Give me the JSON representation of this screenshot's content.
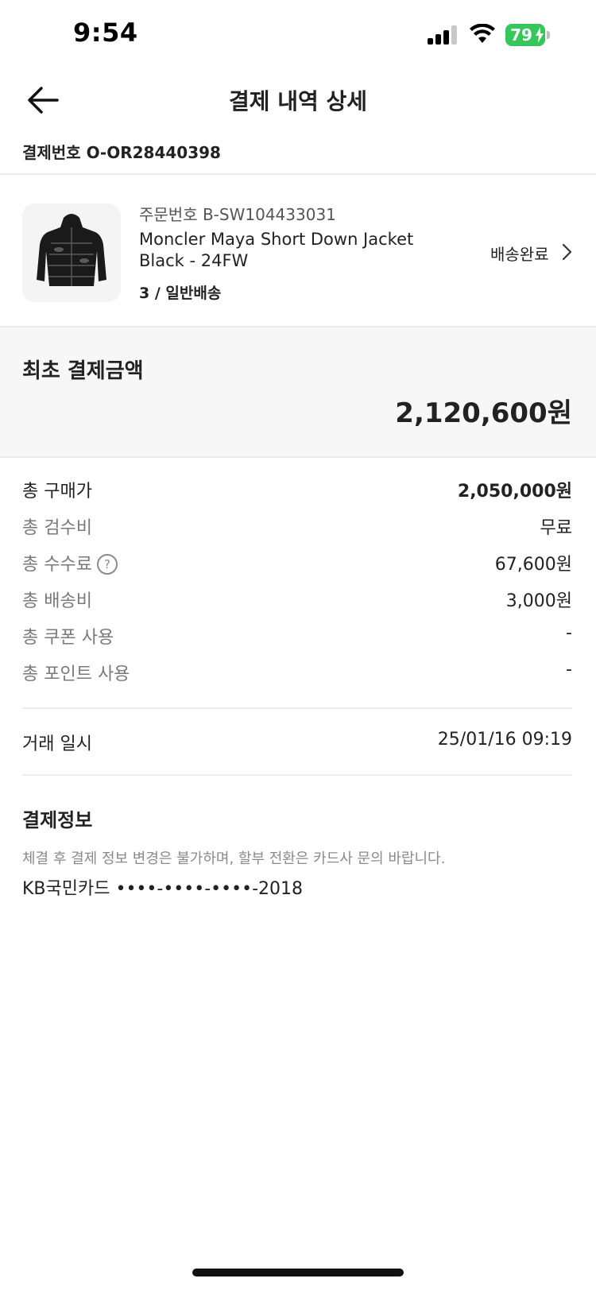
{
  "status_bar": {
    "time": "9:54",
    "battery": "79",
    "icons": [
      "cellular-signal-icon",
      "wifi-icon",
      "battery-charging-icon"
    ]
  },
  "nav": {
    "back_icon": "arrow-left-icon",
    "title": "결제 내역 상세"
  },
  "payment_number": "결제번호 O-OR28440398",
  "product": {
    "image": "black-down-jacket-thumbnail",
    "order_number": "주문번호 B-SW104433031",
    "name": "Moncler Maya Short Down Jacket Black - 24FW",
    "shipping": "3 / 일반배송",
    "status": "배송완료",
    "chevron_icon": "chevron-right-icon"
  },
  "total": {
    "label": "최초 결제금액",
    "value": "2,120,600원"
  },
  "breakdown": [
    {
      "label": "총 구매가",
      "value": "2,050,000원"
    },
    {
      "label": "총 검수비",
      "value": "무료"
    },
    {
      "label": "총 수수료",
      "value": "67,600원",
      "help_icon": "question-circle-icon",
      "help_glyph": "?"
    },
    {
      "label": "총 배송비",
      "value": "3,000원"
    },
    {
      "label": "총 쿠폰 사용",
      "value": "-"
    },
    {
      "label": "총 포인트 사용",
      "value": "-"
    }
  ],
  "transaction": {
    "label": "거래 일시",
    "value": "25/01/16 09:19"
  },
  "payment_info": {
    "title": "결제정보",
    "note": "체결 후 결제 정보 변경은 불가하며, 할부 전환은 카드사 문의 바랍니다.",
    "card": "KB국민카드 ••••-••••-••••-2018"
  },
  "colors": {
    "text": "#222222",
    "muted": "#7a7a7a",
    "panel": "#f7f7f7",
    "divider": "#ebebeb",
    "battery": "#35c759"
  }
}
